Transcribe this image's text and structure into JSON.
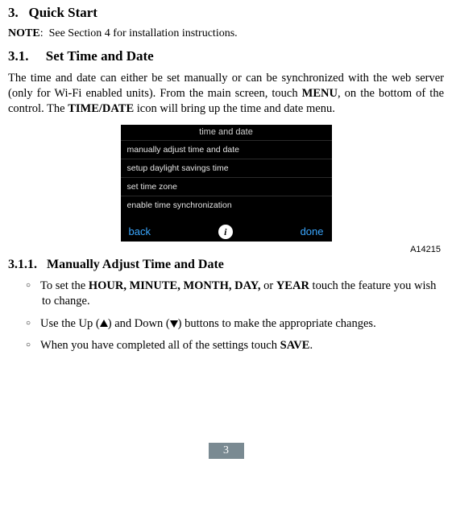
{
  "section": {
    "number": "3.",
    "title": "Quick Start"
  },
  "note": {
    "label": "NOTE",
    "text": "See Section 4 for installation instructions."
  },
  "subsection": {
    "number": "3.1.",
    "title": "Set Time and Date"
  },
  "paragraph": {
    "pre": "The time and date can either be set manually or can be synchronized with the web server (only for Wi-Fi enabled units). From the main screen, touch ",
    "menu": "MENU",
    "mid": ", on the bottom of the control. The ",
    "timedate": "TIME/DATE",
    "post": " icon will bring up the time and date menu."
  },
  "device": {
    "title": "time and date",
    "rows": [
      "manually adjust time and date",
      "setup daylight savings time",
      "set time zone",
      "enable time synchronization"
    ],
    "back": "back",
    "done": "done",
    "info": "i"
  },
  "figure_id": "A14215",
  "subsubsection": {
    "number": "3.1.1.",
    "title": "Manually Adjust Time and Date"
  },
  "bullets": {
    "b1_pre": "To set the ",
    "b1_bold": "HOUR, MINUTE, MONTH, DAY,",
    "b1_mid": " or ",
    "b1_bold2": "YEAR",
    "b1_post": " touch the feature you wish to change.",
    "b2_pre": "Use the Up (",
    "b2_mid": ") and Down (",
    "b2_post": ") buttons to make the appropriate changes.",
    "b3_pre": "When you have completed all of the settings touch ",
    "b3_bold": "SAVE",
    "b3_post": "."
  },
  "page_number": "3"
}
